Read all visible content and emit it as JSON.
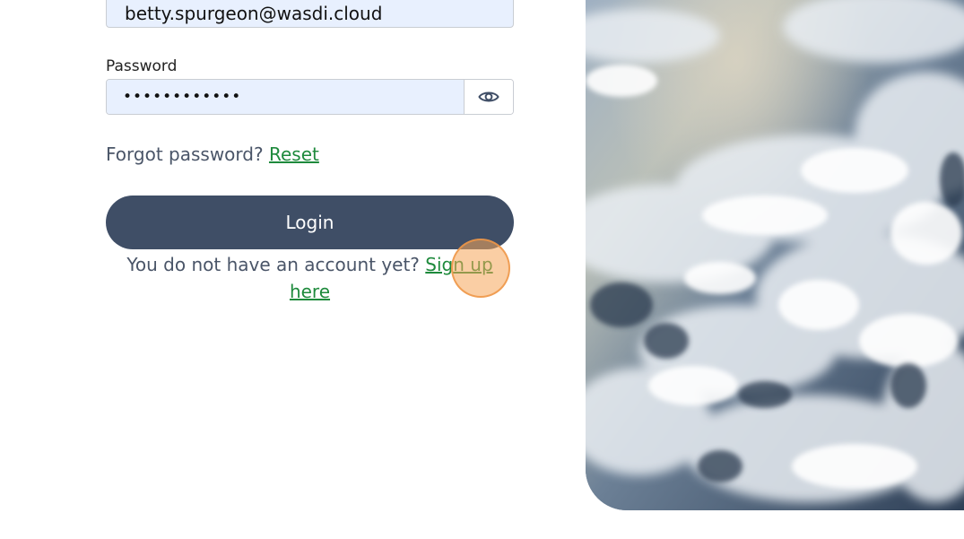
{
  "login_form": {
    "email_value": "betty.spurgeon@wasdi.cloud",
    "password_label": "Password",
    "password_value": "••••••••••••",
    "show_password_icon": "eye-icon",
    "forgot_text": "Forgot password?",
    "reset_link": "Reset",
    "login_button": "Login",
    "signup_text": "You do not have an account yet?",
    "signup_link": "Sign up here"
  },
  "hero_image": {
    "subject": "earth-clouds-from-orbit"
  },
  "colors": {
    "button_bg": "#3f4e66",
    "link": "#1e8a3c",
    "input_autofill_bg": "#e8f0fe",
    "click_marker": "#f5a65a"
  }
}
